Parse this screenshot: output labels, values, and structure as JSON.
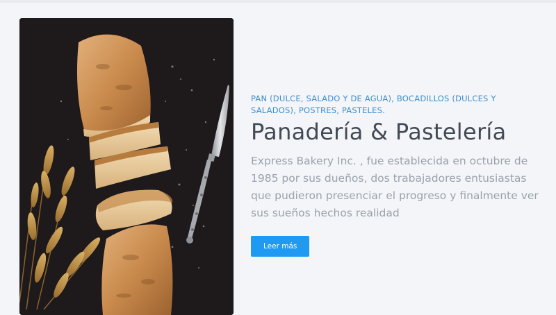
{
  "hero": {
    "subtitle": "PAN (DULCE, SALADO Y DE AGUA), BOCADILLOS (DULCES Y SALADOS), POSTRES, PASTELES.",
    "title": "Panadería & Pastelería",
    "description": "Express Bakery Inc. , fue establecida en octubre de 1985 por sus dueños, dos trabajadores entusiastas que pudieron presenciar el progreso y finalmente ver sus sueños hechos realidad",
    "button_label": "Leer más"
  },
  "colors": {
    "accent": "#1e9af3",
    "subtitle": "#3d8ed0",
    "title": "#424a55",
    "body": "#9aa2ad",
    "background": "#f4f5f8"
  }
}
